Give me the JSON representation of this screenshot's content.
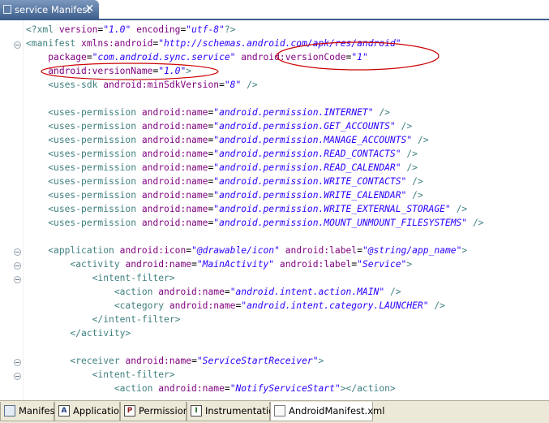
{
  "editor_tab": {
    "title": "service Manifest",
    "close": "✕"
  },
  "code_lines": [
    [
      [
        "t",
        "<?xml "
      ],
      [
        "a",
        "version"
      ],
      [
        "p",
        "="
      ],
      [
        "v",
        "\"1.0\""
      ],
      [
        "p",
        " "
      ],
      [
        "a",
        "encoding"
      ],
      [
        "p",
        "="
      ],
      [
        "v",
        "\"utf-8\""
      ],
      [
        "t",
        "?>"
      ]
    ],
    [
      [
        "t",
        "<manifest "
      ],
      [
        "a",
        "xmlns:android"
      ],
      [
        "p",
        "="
      ],
      [
        "v",
        "\"http://schemas.android.com/apk/res/android\""
      ]
    ],
    [
      [
        "p",
        "    "
      ],
      [
        "a",
        "package"
      ],
      [
        "p",
        "="
      ],
      [
        "v",
        "\"com.android.sync.service\""
      ],
      [
        "p",
        " "
      ],
      [
        "a",
        "android:versionCode"
      ],
      [
        "p",
        "="
      ],
      [
        "v",
        "\"1\""
      ]
    ],
    [
      [
        "p",
        "    "
      ],
      [
        "a",
        "android:versionName"
      ],
      [
        "p",
        "="
      ],
      [
        "v",
        "\"1.0\""
      ],
      [
        "t",
        ">"
      ]
    ],
    [
      [
        "p",
        "    "
      ],
      [
        "t",
        "<uses-sdk "
      ],
      [
        "a",
        "android:minSdkVersion"
      ],
      [
        "p",
        "="
      ],
      [
        "v",
        "\"8\""
      ],
      [
        "p",
        " "
      ],
      [
        "t",
        "/>"
      ]
    ],
    [],
    [
      [
        "p",
        "    "
      ],
      [
        "t",
        "<uses-permission "
      ],
      [
        "a",
        "android:name"
      ],
      [
        "p",
        "="
      ],
      [
        "v",
        "\"android.permission.INTERNET\""
      ],
      [
        "p",
        " "
      ],
      [
        "t",
        "/>"
      ]
    ],
    [
      [
        "p",
        "    "
      ],
      [
        "t",
        "<uses-permission "
      ],
      [
        "a",
        "android:name"
      ],
      [
        "p",
        "="
      ],
      [
        "v",
        "\"android.permission.GET_ACCOUNTS\""
      ],
      [
        "p",
        " "
      ],
      [
        "t",
        "/>"
      ]
    ],
    [
      [
        "p",
        "    "
      ],
      [
        "t",
        "<uses-permission "
      ],
      [
        "a",
        "android:name"
      ],
      [
        "p",
        "="
      ],
      [
        "v",
        "\"android.permission.MANAGE_ACCOUNTS\""
      ],
      [
        "p",
        " "
      ],
      [
        "t",
        "/>"
      ]
    ],
    [
      [
        "p",
        "    "
      ],
      [
        "t",
        "<uses-permission "
      ],
      [
        "a",
        "android:name"
      ],
      [
        "p",
        "="
      ],
      [
        "v",
        "\"android.permission.READ_CONTACTS\""
      ],
      [
        "p",
        " "
      ],
      [
        "t",
        "/>"
      ]
    ],
    [
      [
        "p",
        "    "
      ],
      [
        "t",
        "<uses-permission "
      ],
      [
        "a",
        "android:name"
      ],
      [
        "p",
        "="
      ],
      [
        "v",
        "\"android.permission.READ_CALENDAR\""
      ],
      [
        "p",
        " "
      ],
      [
        "t",
        "/>"
      ]
    ],
    [
      [
        "p",
        "    "
      ],
      [
        "t",
        "<uses-permission "
      ],
      [
        "a",
        "android:name"
      ],
      [
        "p",
        "="
      ],
      [
        "v",
        "\"android.permission.WRITE_CONTACTS\""
      ],
      [
        "p",
        " "
      ],
      [
        "t",
        "/>"
      ]
    ],
    [
      [
        "p",
        "    "
      ],
      [
        "t",
        "<uses-permission "
      ],
      [
        "a",
        "android:name"
      ],
      [
        "p",
        "="
      ],
      [
        "v",
        "\"android.permission.WRITE_CALENDAR\""
      ],
      [
        "p",
        " "
      ],
      [
        "t",
        "/>"
      ]
    ],
    [
      [
        "p",
        "    "
      ],
      [
        "t",
        "<uses-permission "
      ],
      [
        "a",
        "android:name"
      ],
      [
        "p",
        "="
      ],
      [
        "v",
        "\"android.permission.WRITE_EXTERNAL_STORAGE\""
      ],
      [
        "p",
        " "
      ],
      [
        "t",
        "/>"
      ]
    ],
    [
      [
        "p",
        "    "
      ],
      [
        "t",
        "<uses-permission "
      ],
      [
        "a",
        "android:name"
      ],
      [
        "p",
        "="
      ],
      [
        "v",
        "\"android.permission.MOUNT_UNMOUNT_FILESYSTEMS\""
      ],
      [
        "p",
        " "
      ],
      [
        "t",
        "/>"
      ]
    ],
    [],
    [
      [
        "p",
        "    "
      ],
      [
        "t",
        "<application "
      ],
      [
        "a",
        "android:icon"
      ],
      [
        "p",
        "="
      ],
      [
        "v",
        "\"@drawable/icon\""
      ],
      [
        "p",
        " "
      ],
      [
        "a",
        "android:label"
      ],
      [
        "p",
        "="
      ],
      [
        "v",
        "\"@string/app_name\""
      ],
      [
        "t",
        ">"
      ]
    ],
    [
      [
        "p",
        "        "
      ],
      [
        "t",
        "<activity "
      ],
      [
        "a",
        "android:name"
      ],
      [
        "p",
        "="
      ],
      [
        "v",
        "\"MainActivity\""
      ],
      [
        "p",
        " "
      ],
      [
        "a",
        "android:label"
      ],
      [
        "p",
        "="
      ],
      [
        "v",
        "\"Service\""
      ],
      [
        "t",
        ">"
      ]
    ],
    [
      [
        "p",
        "            "
      ],
      [
        "t",
        "<intent-filter>"
      ]
    ],
    [
      [
        "p",
        "                "
      ],
      [
        "t",
        "<action "
      ],
      [
        "a",
        "android:name"
      ],
      [
        "p",
        "="
      ],
      [
        "v",
        "\"android.intent.action.MAIN\""
      ],
      [
        "p",
        " "
      ],
      [
        "t",
        "/>"
      ]
    ],
    [
      [
        "p",
        "                "
      ],
      [
        "t",
        "<category "
      ],
      [
        "a",
        "android:name"
      ],
      [
        "p",
        "="
      ],
      [
        "v",
        "\"android.intent.category.LAUNCHER\""
      ],
      [
        "p",
        " "
      ],
      [
        "t",
        "/>"
      ]
    ],
    [
      [
        "p",
        "            "
      ],
      [
        "t",
        "</intent-filter>"
      ]
    ],
    [
      [
        "p",
        "        "
      ],
      [
        "t",
        "</activity>"
      ]
    ],
    [],
    [
      [
        "p",
        "        "
      ],
      [
        "t",
        "<receiver "
      ],
      [
        "a",
        "android:name"
      ],
      [
        "p",
        "="
      ],
      [
        "v",
        "\"ServiceStartReceiver\""
      ],
      [
        "t",
        ">"
      ]
    ],
    [
      [
        "p",
        "            "
      ],
      [
        "t",
        "<intent-filter>"
      ]
    ],
    [
      [
        "p",
        "                "
      ],
      [
        "t",
        "<action "
      ],
      [
        "a",
        "android:name"
      ],
      [
        "p",
        "="
      ],
      [
        "v",
        "\"NotifyServiceStart\""
      ],
      [
        "t",
        "></action>"
      ]
    ]
  ],
  "page_tabs": [
    {
      "label": "Manifest",
      "icon": "manifest-icon",
      "glyph": ""
    },
    {
      "label": "Application",
      "icon": "application-icon",
      "glyph": "A"
    },
    {
      "label": "Permissions",
      "icon": "permissions-icon",
      "glyph": "P"
    },
    {
      "label": "Instrumentation",
      "icon": "instrumentation-icon",
      "glyph": "I"
    },
    {
      "label": "AndroidManifest.xml",
      "icon": "xml-file-icon",
      "glyph": ""
    }
  ],
  "colors": {
    "tag": "#3f7f7f",
    "attribute": "#7f007f",
    "value": "#2a00ff",
    "annotation": "#cc0000"
  }
}
